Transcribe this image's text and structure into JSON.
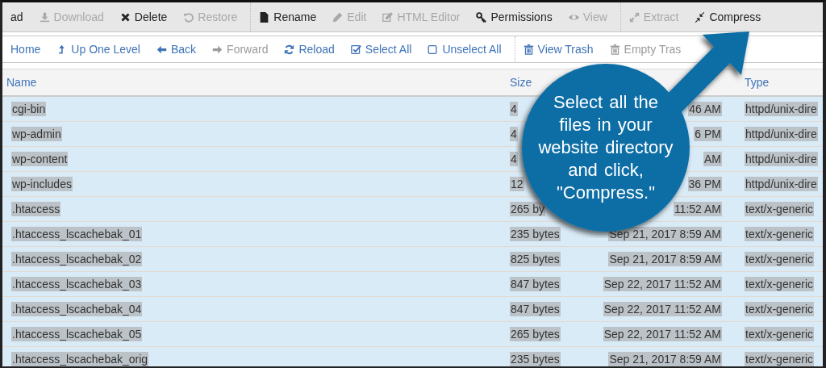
{
  "toolbar": [
    {
      "label": "ad",
      "disabled": false
    },
    {
      "label": "Download",
      "disabled": true
    },
    {
      "label": "Delete",
      "disabled": false
    },
    {
      "label": "Restore",
      "disabled": true
    },
    {
      "label": "Rename",
      "disabled": false,
      "kind": "group-start"
    },
    {
      "label": "Edit",
      "disabled": true
    },
    {
      "label": "HTML Editor",
      "disabled": true
    },
    {
      "label": "Permissions",
      "disabled": false
    },
    {
      "label": "View",
      "disabled": true
    },
    {
      "label": "Extract",
      "disabled": true,
      "kind": "group-start"
    },
    {
      "label": "Compress",
      "disabled": false
    }
  ],
  "nav_toolbar": [
    {
      "label": "Home",
      "disabled": false
    },
    {
      "label": "Up One Level",
      "disabled": false
    },
    {
      "label": "Back",
      "disabled": false
    },
    {
      "label": "Forward",
      "disabled": true
    },
    {
      "label": "Reload",
      "disabled": false
    },
    {
      "label": "Select All",
      "disabled": false
    },
    {
      "label": "Unselect All",
      "disabled": false
    },
    {
      "label": "View Trash",
      "disabled": false,
      "kind": "group-start"
    },
    {
      "label": "Empty Tras",
      "disabled": true
    }
  ],
  "table": {
    "columns": [
      {
        "label": "Name"
      },
      {
        "label": "Size"
      },
      {
        "label": "Type"
      }
    ],
    "rows": [
      {
        "name": "cgi-bin",
        "size": "4",
        "modified": "46 AM",
        "type": "httpd/unix-dire",
        "selected": true
      },
      {
        "name": "wp-admin",
        "size": "4",
        "modified": "6 PM",
        "type": "httpd/unix-dire",
        "selected": true
      },
      {
        "name": "wp-content",
        "size": "4",
        "modified": "AM",
        "type": "httpd/unix-dire",
        "selected": true
      },
      {
        "name": "wp-includes",
        "size": "12",
        "modified": "36 PM",
        "type": "httpd/unix-dire",
        "selected": true
      },
      {
        "name": ".htaccess",
        "size": "265 by",
        "modified": "11:52 AM",
        "type": "text/x-generic",
        "selected": true
      },
      {
        "name": ".htaccess_lscachebak_01",
        "size": "235 bytes",
        "modified": "Sep 21, 2017 8:59 AM",
        "type": "text/x-generic",
        "selected": true
      },
      {
        "name": ".htaccess_lscachebak_02",
        "size": "825 bytes",
        "modified": "Sep 21, 2017 8:59 AM",
        "type": "text/x-generic",
        "selected": true
      },
      {
        "name": ".htaccess_lscachebak_03",
        "size": "847 bytes",
        "modified": "Sep 22, 2017 11:52 AM",
        "type": "text/x-generic",
        "selected": true
      },
      {
        "name": ".htaccess_lscachebak_04",
        "size": "847 bytes",
        "modified": "Sep 22, 2017 11:52 AM",
        "type": "text/x-generic",
        "selected": true
      },
      {
        "name": ".htaccess_lscachebak_05",
        "size": "265 bytes",
        "modified": "Sep 22, 2017 11:52 AM",
        "type": "text/x-generic",
        "selected": true
      },
      {
        "name": ".htaccess_lscachebak_orig",
        "size": "235 bytes",
        "modified": "Sep 21, 2017 8:59 AM",
        "type": "text/x-generic",
        "selected": true
      }
    ]
  },
  "callout": {
    "text": "Select all the files in your website directory and click, \"Compress.\""
  }
}
